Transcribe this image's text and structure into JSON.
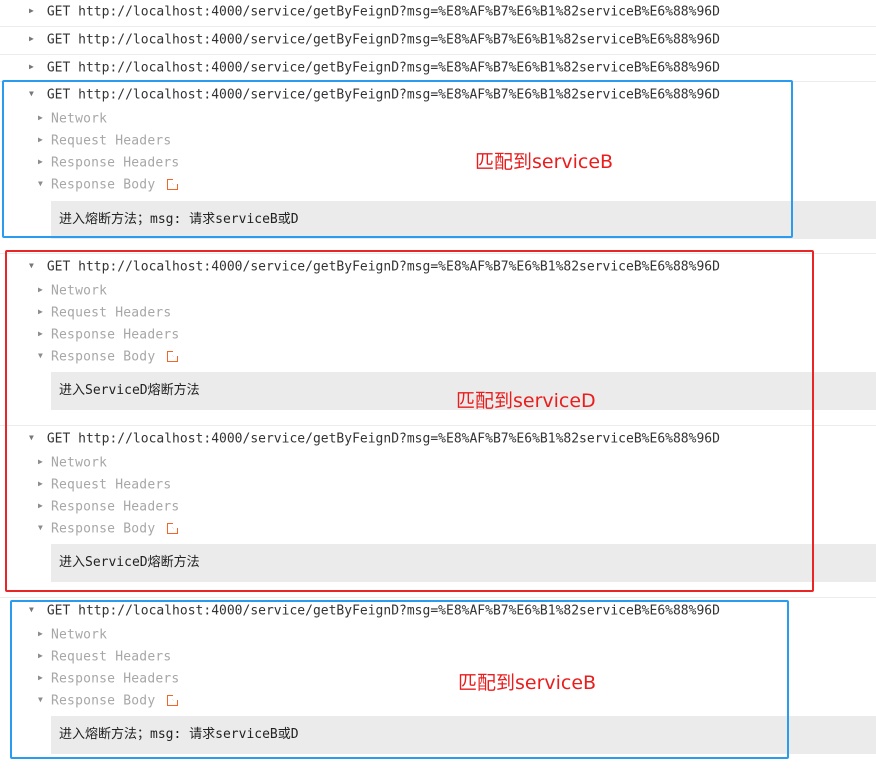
{
  "collapsed_requests": [
    {
      "method": "GET",
      "url": "http://localhost:4000/service/getByFeignD?msg=%E8%AF%B7%E6%B1%82serviceB%E6%88%96D"
    },
    {
      "method": "GET",
      "url": "http://localhost:4000/service/getByFeignD?msg=%E8%AF%B7%E6%B1%82serviceB%E6%88%96D"
    },
    {
      "method": "GET",
      "url": "http://localhost:4000/service/getByFeignD?msg=%E8%AF%B7%E6%B1%82serviceB%E6%88%96D"
    }
  ],
  "expanded_requests": [
    {
      "method": "GET",
      "url": "http://localhost:4000/service/getByFeignD?msg=%E8%AF%B7%E6%B1%82serviceB%E6%88%96D",
      "sections": [
        "Network",
        "Request Headers",
        "Response Headers",
        "Response Body"
      ],
      "response_body": "进入熔断方法；msg: 请求serviceB或D"
    },
    {
      "method": "GET",
      "url": "http://localhost:4000/service/getByFeignD?msg=%E8%AF%B7%E6%B1%82serviceB%E6%88%96D",
      "sections": [
        "Network",
        "Request Headers",
        "Response Headers",
        "Response Body"
      ],
      "response_body": "进入ServiceD熔断方法"
    },
    {
      "method": "GET",
      "url": "http://localhost:4000/service/getByFeignD?msg=%E8%AF%B7%E6%B1%82serviceB%E6%88%96D",
      "sections": [
        "Network",
        "Request Headers",
        "Response Headers",
        "Response Body"
      ],
      "response_body": "进入ServiceD熔断方法"
    },
    {
      "method": "GET",
      "url": "http://localhost:4000/service/getByFeignD?msg=%E8%AF%B7%E6%B1%82serviceB%E6%88%96D",
      "sections": [
        "Network",
        "Request Headers",
        "Response Headers",
        "Response Body"
      ],
      "response_body": "进入熔断方法；msg: 请求serviceB或D"
    }
  ],
  "annotations": [
    "匹配到serviceB",
    "匹配到serviceD",
    "匹配到serviceB"
  ],
  "icons": {
    "collapsed": "triangle-right-icon",
    "expanded": "triangle-down-icon",
    "external": "open-external-icon"
  },
  "colors": {
    "blue_frame": "#2a9cf0",
    "red_frame": "#ea2525",
    "annotation": "#ea1d1d",
    "external_icon": "#f5652a"
  }
}
